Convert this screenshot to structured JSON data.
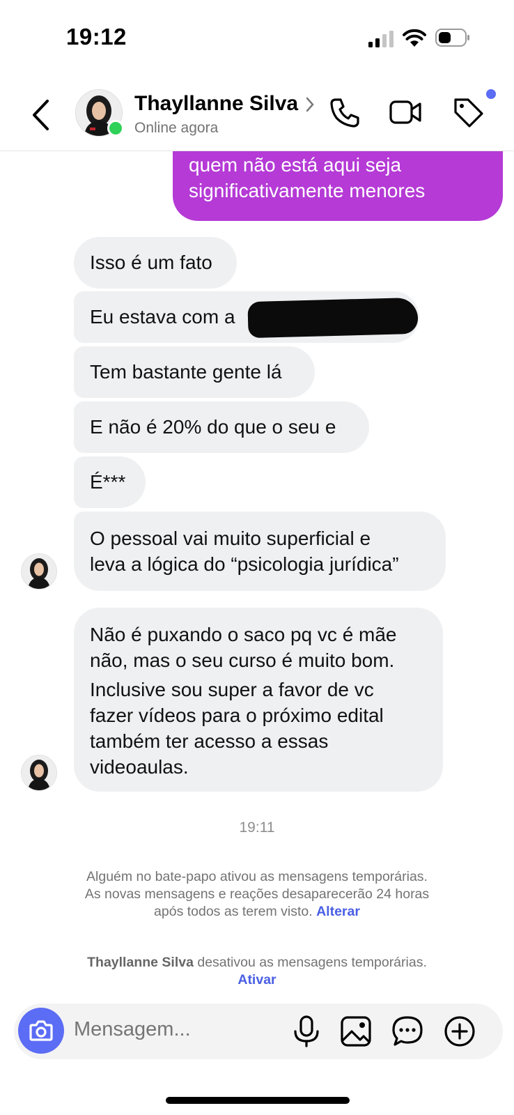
{
  "status_bar": {
    "time": "19:12"
  },
  "header": {
    "name": "Thayllanne Silva",
    "status": "Online agora"
  },
  "messages": {
    "outgoing_partial": [
      "quem não está aqui seja",
      "significativamente menores"
    ],
    "incoming": [
      [
        "Isso é um fato"
      ],
      [
        "Eu estava com a "
      ],
      [
        "Tem bastante gente lá"
      ],
      [
        "E não é 20% do que o seu e"
      ],
      [
        "É***"
      ],
      [
        "O pessoal vai muito superficial e",
        "leva a lógica do “psicologia jurídica”"
      ],
      [
        "Não é puxando o saco pq vc é mãe",
        "não, mas o seu curso é muito bom.",
        "Inclusive sou super a favor de vc",
        "fazer vídeos para o próximo edital",
        "também ter acesso a essas",
        "videoaulas."
      ]
    ]
  },
  "timestamp": "19:11",
  "system": {
    "notice1_line1": "Alguém no bate-papo ativou as mensagens temporárias.",
    "notice1_line2": "As novas mensagens e reações desaparecerão 24 horas",
    "notice1_line3": "após todos as terem visto.",
    "notice1_link": "Alterar",
    "notice2_name": "Thayllanne Silva",
    "notice2_text": " desativou as mensagens temporárias.",
    "notice2_link": "Ativar"
  },
  "composer": {
    "placeholder": "Mensagem..."
  },
  "colors": {
    "outgoing": "#b53ad6",
    "accent": "#5b6cf5",
    "online": "#2fd158",
    "incoming": "#eff0f2"
  },
  "icons": [
    "signal-icon",
    "wifi-icon",
    "battery-icon",
    "back-icon",
    "chevron-right-icon",
    "phone-icon",
    "video-icon",
    "tag-icon",
    "camera-icon",
    "mic-icon",
    "image-icon",
    "sticker-icon",
    "plus-icon"
  ]
}
